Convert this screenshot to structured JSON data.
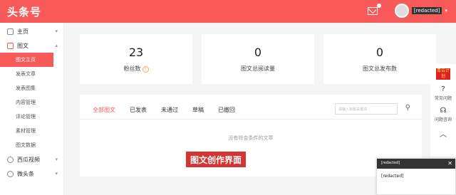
{
  "header": {
    "logo": "头条号",
    "username": "[redacted]"
  },
  "sidebar": {
    "items": [
      {
        "label": "主页"
      },
      {
        "label": "图文"
      }
    ],
    "subitems": [
      "图文主页",
      "发表文章",
      "发表图集",
      "内容管理",
      "评论管理",
      "素材管理",
      "图文数据"
    ],
    "more": [
      {
        "label": "西瓜视频"
      },
      {
        "label": "微头条"
      }
    ]
  },
  "stats": [
    {
      "value": "23",
      "label": "粉丝数"
    },
    {
      "value": "0",
      "label": "图文总阅读量"
    },
    {
      "value": "0",
      "label": "图文总发布数"
    }
  ],
  "tabs": [
    "全部图文",
    "已发表",
    "未通过",
    "草稿",
    "已撤回"
  ],
  "search": {
    "placeholder": "请输入标题关键词"
  },
  "empty": "没有符合条件的文章",
  "annotation": "图文创作界面",
  "rightbar": {
    "plan": "青云计划",
    "faq": "常见问题",
    "consult": "问题咨询"
  },
  "notify": {
    "title": "[redacted]",
    "body": "[redacted]"
  },
  "colors": {
    "accent": "#f85959"
  }
}
